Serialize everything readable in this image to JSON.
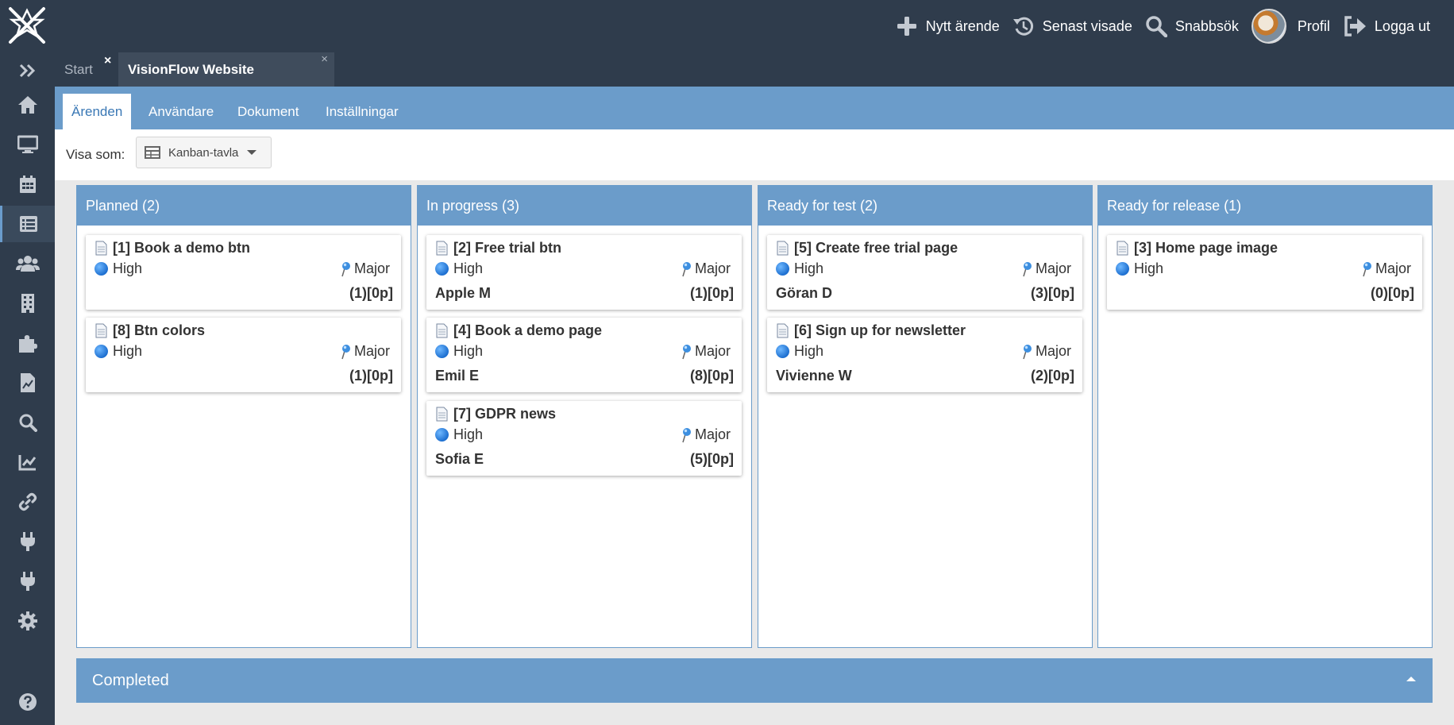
{
  "topnav": {
    "new_case": "Nytt ärende",
    "recent": "Senast visade",
    "quick_search": "Snabbsök",
    "profile": "Profil",
    "logout": "Logga ut"
  },
  "tabs": {
    "start": "Start",
    "active": "VisionFlow Website",
    "close_glyph": "×"
  },
  "subtabs": [
    "Ärenden",
    "Användare",
    "Dokument",
    "Inställningar"
  ],
  "view": {
    "label": "Visa som:",
    "selected": "Kanban-tavla"
  },
  "sidebar": {
    "items": [
      "expand-icon",
      "home-icon",
      "monitor-icon",
      "calendar-icon",
      "list-icon",
      "users-icon",
      "building-icon",
      "puzzle-icon",
      "file-chart-icon",
      "search-icon",
      "trend-chart-icon",
      "link-icon",
      "plug-icon",
      "plug-icon",
      "gear-icon",
      "help-icon"
    ],
    "active_index": 4
  },
  "columns": [
    {
      "title": "Planned (2)",
      "cards": [
        {
          "title": "[1] Book a demo btn",
          "priority": "High",
          "severity": "Major",
          "assignee": "",
          "count": "(1)[0p]"
        },
        {
          "title": "[8] Btn colors",
          "priority": "High",
          "severity": "Major",
          "assignee": "",
          "count": "(1)[0p]"
        }
      ]
    },
    {
      "title": "In progress (3)",
      "cards": [
        {
          "title": "[2] Free trial btn",
          "priority": "High",
          "severity": "Major",
          "assignee": "Apple M",
          "count": "(1)[0p]"
        },
        {
          "title": "[4] Book a demo page",
          "priority": "High",
          "severity": "Major",
          "assignee": "Emil E",
          "count": "(8)[0p]"
        },
        {
          "title": "[7] GDPR news",
          "priority": "High",
          "severity": "Major",
          "assignee": "Sofia E",
          "count": "(5)[0p]"
        }
      ]
    },
    {
      "title": "Ready for test (2)",
      "cards": [
        {
          "title": "[5] Create free trial page",
          "priority": "High",
          "severity": "Major",
          "assignee": "Göran D",
          "count": "(3)[0p]"
        },
        {
          "title": "[6] Sign up for newsletter",
          "priority": "High",
          "severity": "Major",
          "assignee": "Vivienne W",
          "count": "(2)[0p]"
        }
      ]
    },
    {
      "title": "Ready for release (1)",
      "cards": [
        {
          "title": "[3] Home page image",
          "priority": "High",
          "severity": "Major",
          "assignee": "",
          "count": "(0)[0p]"
        }
      ]
    }
  ],
  "completed": "Completed",
  "colors": {
    "dark": "#2f3c4c",
    "accent": "#6b9cca",
    "priority_dot": "#1d6fd0"
  }
}
